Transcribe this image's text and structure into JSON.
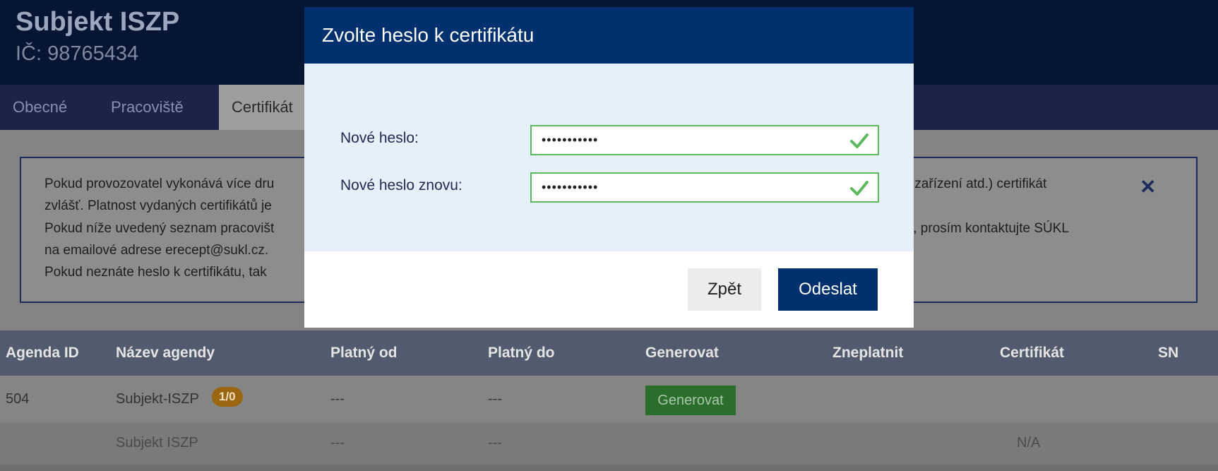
{
  "header": {
    "title": "Subjekt ISZP",
    "ic": "IČ: 98765434"
  },
  "tabs": [
    {
      "label": "Obecné"
    },
    {
      "label": "Pracoviště"
    },
    {
      "label": "Certifikát"
    }
  ],
  "info": {
    "lines": [
      "Pokud provozovatel vykonává více dru",
      "zvlášť. Platnost vydaných certifikátů je",
      "Pokud níže uvedený seznam pracovišt",
      "na emailové adrese erecept@sukl.cz.",
      "Pokud neznáte heslo k certifikátu, tak"
    ],
    "line1_tail": "ké zařízení atd.) certifikát",
    "line3_tail": "KL, prosím kontaktujte SÚKL",
    "close_glyph": "✕"
  },
  "table": {
    "headers": [
      "Agenda ID",
      "Název agendy",
      "Platný od",
      "Platný do",
      "Generovat",
      "Zneplatnit",
      "Certifikát",
      "SN"
    ],
    "row1": {
      "agenda_id": "504",
      "name": "Subjekt-ISZP",
      "badge": "1/0",
      "from": "---",
      "to": "---",
      "generate_label": "Generovat"
    },
    "row2": {
      "name": "Subjekt ISZP",
      "from": "---",
      "to": "---",
      "certificate": "N/A"
    }
  },
  "modal": {
    "title": "Zvolte heslo k certifikátu",
    "new_password_label": "Nové heslo:",
    "new_password_value": "•••••••••••",
    "repeat_password_label": "Nové heslo znovu:",
    "repeat_password_value": "•••••••••••",
    "back_label": "Zpět",
    "submit_label": "Odeslat"
  },
  "colors": {
    "primary": "#00306d",
    "valid_green": "#5cb85c",
    "generate_green": "#2b6e2b",
    "badge_orange": "#9a6710"
  },
  "icons": [
    "check-icon",
    "close-icon"
  ]
}
